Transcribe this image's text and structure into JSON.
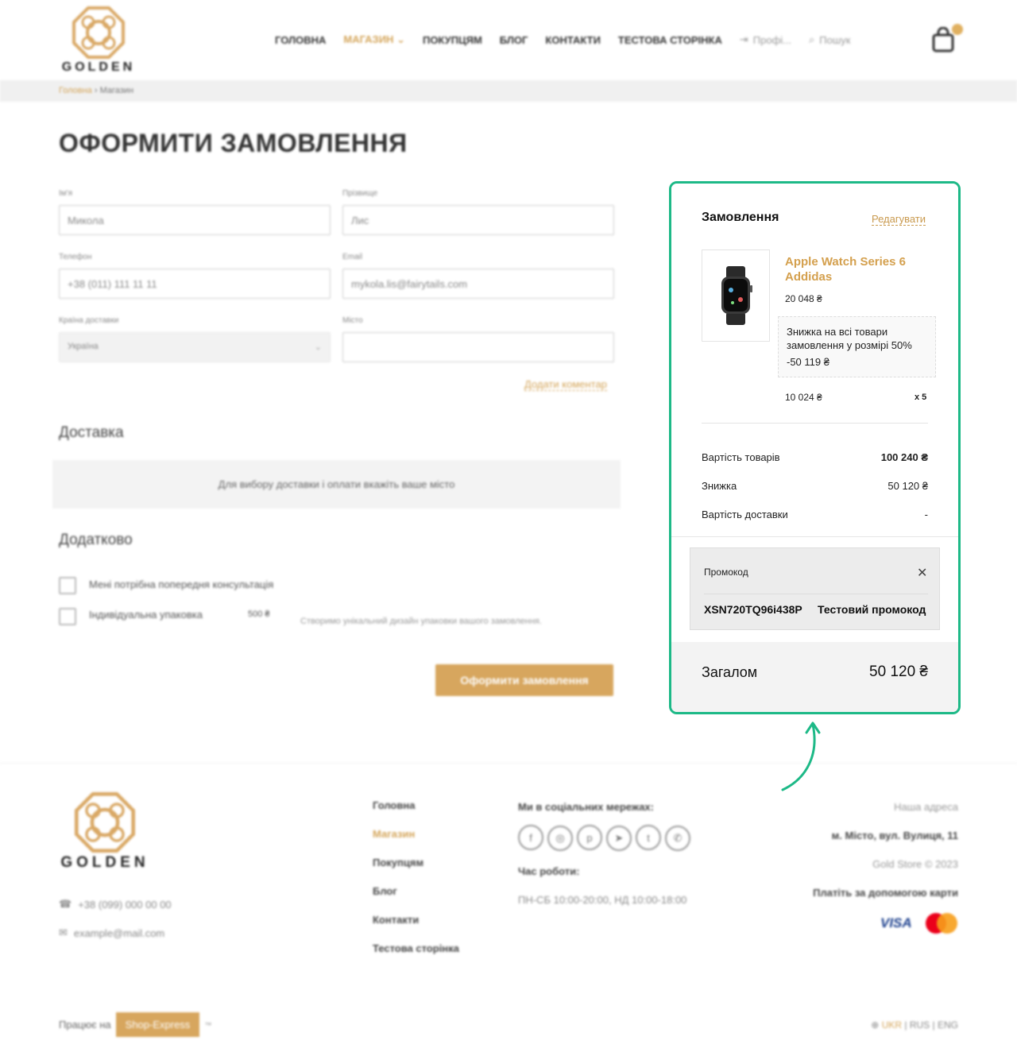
{
  "header": {
    "logo_text": "GOLDEN",
    "nav": [
      "ГОЛОВНА",
      "МАГАЗИН",
      "ПОКУПЦЯМ",
      "БЛОГ",
      "КОНТАКТИ",
      "ТЕСТОВА СТОРІНКА"
    ],
    "nav_active_index": 1,
    "profile_label": "Профі...",
    "search_label": "Пошук",
    "cart_count": ""
  },
  "breadcrumb": {
    "home": "Головна",
    "current": "Магазин"
  },
  "page_title": "ОФОРМИТИ ЗАМОВЛЕННЯ",
  "form": {
    "first_name_label": "Ім'я",
    "first_name_value": "Микола",
    "last_name_label": "Прізвище",
    "last_name_value": "Лис",
    "phone_label": "Телефон",
    "phone_value": "+38 (011) 111 11 11",
    "email_label": "Email",
    "email_value": "mykola.lis@fairytails.com",
    "country_label": "Країна доставки",
    "country_value": "Україна",
    "city_label": "Місто",
    "city_value": "",
    "add_comment": "Додати коментар"
  },
  "delivery": {
    "heading": "Доставка",
    "notice": "Для вибору доставки і оплати вкажіть ваше місто"
  },
  "extra": {
    "heading": "Додатково",
    "consult_label": "Мені потрібна попередня консультація",
    "packaging_label": "Індивідуальна упаковка",
    "packaging_price": "500 ₴",
    "packaging_note": "Створимо унікальний дизайн упаковки вашого замовлення."
  },
  "submit_label": "Оформити замовлення",
  "order": {
    "title": "Замовлення",
    "edit": "Редагувати",
    "item": {
      "name": "Apple Watch Series 6 Addidas",
      "price": "20 048 ₴",
      "discount_text": "Знижка на всі товари замовлення у розмірі 50%",
      "discount_value": "-50 119 ₴",
      "unit_price": "10 024 ₴",
      "qty": "x 5"
    },
    "goods_cost_label": "Вартість товарів",
    "goods_cost": "100 240 ₴",
    "discount_label": "Знижка",
    "discount": "50 120 ₴",
    "delivery_label": "Вартість доставки",
    "delivery": "-",
    "promo_label": "Промокод",
    "promo_code": "XSN720TQ96i438P",
    "promo_name": "Тестовий промокод",
    "total_label": "Загалом",
    "total": "50 120 ₴"
  },
  "footer": {
    "logo_text": "GOLDEN",
    "phone": "+38 (099) 000 00 00",
    "email": "example@mail.com",
    "nav": [
      "Головна",
      "Магазин",
      "Покупцям",
      "Блог",
      "Контакти",
      "Тестова сторінка"
    ],
    "social_heading": "Ми в соціальних мережах:",
    "hours_heading": "Час роботи:",
    "hours": "ПН-СБ 10:00-20:00, НД 10:00-18:00",
    "address_heading": "Наша адреса",
    "address": "м. Місто, вул. Вулиця, 11",
    "copyright": "Gold Store © 2023",
    "cards_heading": "Платіть за допомогою карти",
    "visa": "VISA",
    "powered_prefix": "Працює на",
    "powered_brand": "Shop-Express",
    "powered_suffix": "™",
    "langs": [
      "UKR",
      "RUS",
      "ENG"
    ]
  },
  "colors": {
    "accent": "#d7a65e",
    "highlight": "#1db987"
  }
}
